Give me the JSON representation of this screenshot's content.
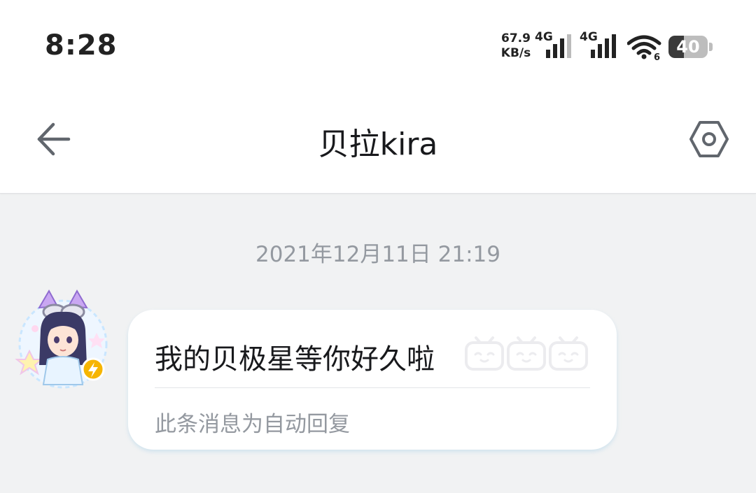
{
  "status_bar": {
    "time": "8:28",
    "net_speed_value": "67.9",
    "net_speed_unit": "KB/s",
    "signal1_label": "4G",
    "signal2_label": "4G",
    "wifi_badge": "6",
    "battery": "40",
    "battery_level": 0.4
  },
  "header": {
    "title": "贝拉kira",
    "back_icon": "arrow-left-icon",
    "settings_icon": "hexagon-settings-icon"
  },
  "chat": {
    "date": "2021年12月11日 21:19",
    "message": {
      "text": "我的贝极星等你好久啦",
      "emote_icon": "bilibili-tv-emote-icon",
      "emote_count": 3,
      "auto_reply_note": "此条消息为自动回复"
    }
  },
  "colors": {
    "background": "#f1f2f3",
    "header_bg": "#ffffff",
    "text_primary": "#18191c",
    "text_secondary": "#9499a0",
    "avatar_badge": "#f6b500"
  }
}
